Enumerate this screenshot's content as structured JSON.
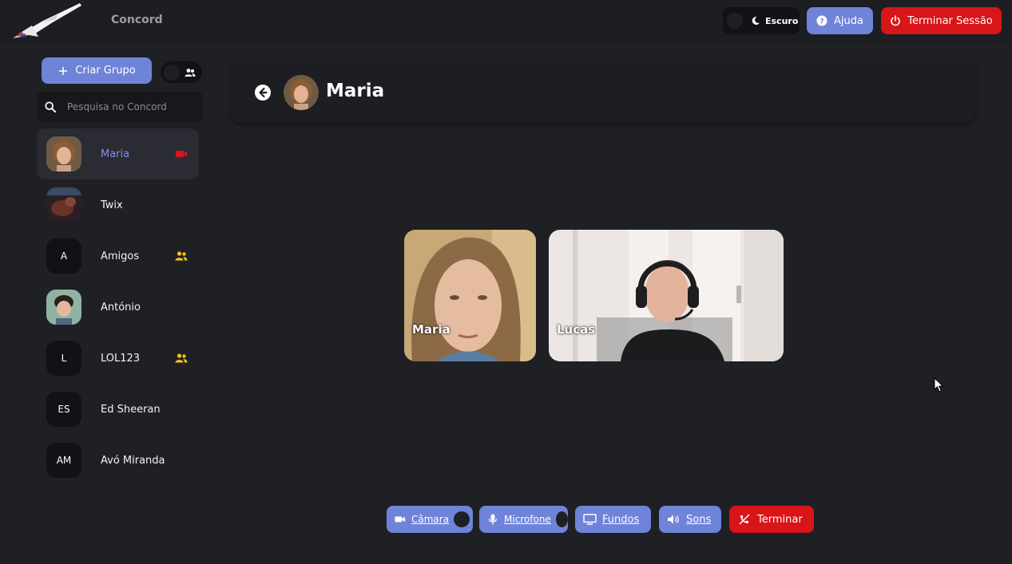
{
  "app": {
    "name": "Concord"
  },
  "topbar": {
    "theme_label": "Escuro",
    "help_label": "Ajuda",
    "logout_label": "Terminar Sessão"
  },
  "sidebar": {
    "create_group_label": "Criar Grupo",
    "search_placeholder": "Pesquisa no Concord",
    "contacts": [
      {
        "name": "Maria",
        "avatar": "photo",
        "badge": "video-call-icon",
        "active": true
      },
      {
        "name": "Twix",
        "avatar": "photo"
      },
      {
        "name": "Amigos",
        "initials": "A",
        "badge": "group-icon"
      },
      {
        "name": "António",
        "avatar": "photo"
      },
      {
        "name": "LOL123",
        "initials": "L",
        "badge": "group-icon"
      },
      {
        "name": "Ed Sheeran",
        "initials": "ES"
      },
      {
        "name": "Avó Miranda",
        "initials": "AM"
      }
    ]
  },
  "chat": {
    "title": "Maria",
    "participants": [
      {
        "name": "Maria"
      },
      {
        "name": "Lucas"
      }
    ]
  },
  "controls": {
    "camera_label": "Câmara",
    "mic_label": "Microfone",
    "backgrounds_label": "Fundos",
    "sounds_label": "Sons",
    "end_label": "Terminar"
  },
  "colors": {
    "accent": "#6f83d9",
    "danger": "#d81518",
    "background": "#1f2024",
    "group_badge": "#f2c21b"
  }
}
